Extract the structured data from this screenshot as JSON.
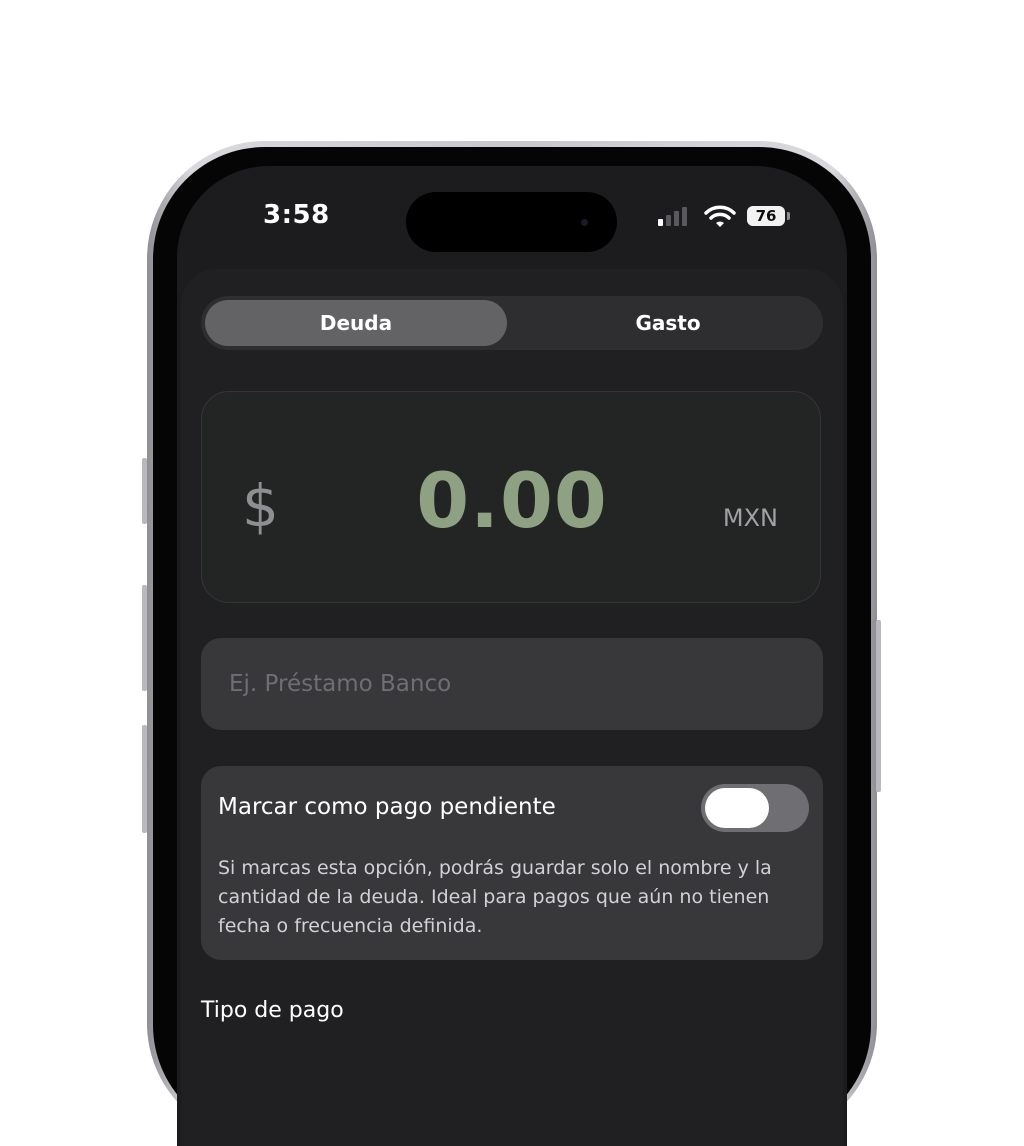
{
  "status_bar": {
    "time": "3:58",
    "battery": "76",
    "icons": [
      "signal-icon",
      "wifi-icon",
      "battery-icon"
    ]
  },
  "segmented_control": {
    "options": [
      {
        "label": "Deuda",
        "selected": true
      },
      {
        "label": "Gasto",
        "selected": false
      }
    ]
  },
  "amount": {
    "symbol": "$",
    "value": "0.00",
    "currency": "MXN",
    "value_color": "#8ea283"
  },
  "name_field": {
    "value": "",
    "placeholder": "Ej. Préstamo Banco"
  },
  "pending": {
    "label": "Marcar como pago pendiente",
    "toggle_on": false,
    "help": "Si marcas esta opción, podrás guardar solo el nombre y la cantidad de la deuda. Ideal para pagos que aún no tienen fecha o frecuencia definida."
  },
  "payment_type": {
    "label": "Tipo de pago"
  }
}
